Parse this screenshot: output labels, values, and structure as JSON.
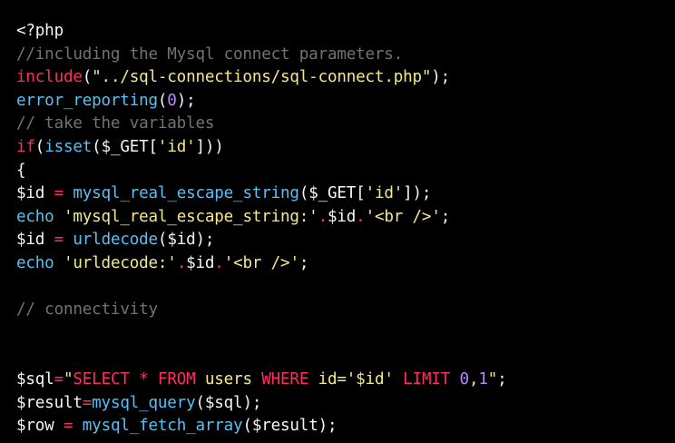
{
  "editor": {
    "theme": {
      "background": "#000000",
      "plain": "#f5f5f5",
      "comment": "#6f7276",
      "keyword": "#ff2e5f",
      "function": "#58c0f4",
      "string": "#f3e98c",
      "number": "#b488ff"
    },
    "lines": [
      [
        {
          "t": "plain",
          "v": "<?php"
        }
      ],
      [
        {
          "t": "comment",
          "v": "//including the Mysql connect parameters."
        }
      ],
      [
        {
          "t": "keyword",
          "v": "include"
        },
        {
          "t": "plain",
          "v": "("
        },
        {
          "t": "string",
          "v": "\"../sql-connections/sql-connect.php\""
        },
        {
          "t": "plain",
          "v": ");"
        }
      ],
      [
        {
          "t": "func",
          "v": "error_reporting"
        },
        {
          "t": "plain",
          "v": "("
        },
        {
          "t": "number",
          "v": "0"
        },
        {
          "t": "plain",
          "v": ");"
        }
      ],
      [
        {
          "t": "comment",
          "v": "// take the variables"
        }
      ],
      [
        {
          "t": "keyword",
          "v": "if"
        },
        {
          "t": "plain",
          "v": "("
        },
        {
          "t": "func",
          "v": "isset"
        },
        {
          "t": "plain",
          "v": "($_GET["
        },
        {
          "t": "string",
          "v": "'id'"
        },
        {
          "t": "plain",
          "v": "]))"
        }
      ],
      [
        {
          "t": "plain",
          "v": "{"
        }
      ],
      [
        {
          "t": "plain",
          "v": "$id "
        },
        {
          "t": "keyword",
          "v": "="
        },
        {
          "t": "plain",
          "v": " "
        },
        {
          "t": "func",
          "v": "mysql_real_escape_string"
        },
        {
          "t": "plain",
          "v": "($_GET["
        },
        {
          "t": "string",
          "v": "'id'"
        },
        {
          "t": "plain",
          "v": "]);"
        }
      ],
      [
        {
          "t": "func",
          "v": "echo"
        },
        {
          "t": "plain",
          "v": " "
        },
        {
          "t": "string",
          "v": "'mysql_real_escape_string:'"
        },
        {
          "t": "keyword",
          "v": "."
        },
        {
          "t": "plain",
          "v": "$id"
        },
        {
          "t": "keyword",
          "v": "."
        },
        {
          "t": "string",
          "v": "'<br />'"
        },
        {
          "t": "plain",
          "v": ";"
        }
      ],
      [
        {
          "t": "plain",
          "v": "$id "
        },
        {
          "t": "keyword",
          "v": "="
        },
        {
          "t": "plain",
          "v": " "
        },
        {
          "t": "func",
          "v": "urldecode"
        },
        {
          "t": "plain",
          "v": "($id);"
        }
      ],
      [
        {
          "t": "func",
          "v": "echo"
        },
        {
          "t": "plain",
          "v": " "
        },
        {
          "t": "string",
          "v": "'urldecode:'"
        },
        {
          "t": "keyword",
          "v": "."
        },
        {
          "t": "plain",
          "v": "$id"
        },
        {
          "t": "keyword",
          "v": "."
        },
        {
          "t": "string",
          "v": "'<br />'"
        },
        {
          "t": "plain",
          "v": ";"
        }
      ],
      [],
      [
        {
          "t": "comment",
          "v": "// connectivity"
        }
      ],
      [],
      [],
      [
        {
          "t": "plain",
          "v": "$sql"
        },
        {
          "t": "keyword",
          "v": "="
        },
        {
          "t": "string",
          "v": "\""
        },
        {
          "t": "keyword",
          "v": "SELECT * FROM"
        },
        {
          "t": "string",
          "v": " users "
        },
        {
          "t": "keyword",
          "v": "WHERE"
        },
        {
          "t": "string",
          "v": " id='$id' "
        },
        {
          "t": "keyword",
          "v": "LIMIT"
        },
        {
          "t": "string",
          "v": " "
        },
        {
          "t": "number",
          "v": "0"
        },
        {
          "t": "string",
          "v": ","
        },
        {
          "t": "number",
          "v": "1"
        },
        {
          "t": "string",
          "v": "\""
        },
        {
          "t": "plain",
          "v": ";"
        }
      ],
      [
        {
          "t": "plain",
          "v": "$result"
        },
        {
          "t": "keyword",
          "v": "="
        },
        {
          "t": "func",
          "v": "mysql_query"
        },
        {
          "t": "plain",
          "v": "($sql);"
        }
      ],
      [
        {
          "t": "plain",
          "v": "$row "
        },
        {
          "t": "keyword",
          "v": "="
        },
        {
          "t": "plain",
          "v": " "
        },
        {
          "t": "func",
          "v": "mysql_fetch_array"
        },
        {
          "t": "plain",
          "v": "($result);"
        }
      ]
    ]
  }
}
